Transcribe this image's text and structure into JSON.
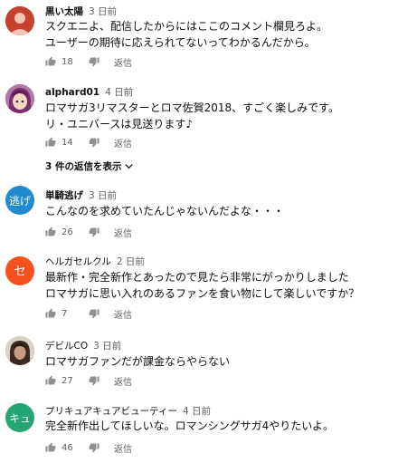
{
  "comments": [
    {
      "author": "黒い太陽",
      "time": "3 日前",
      "avatar": {
        "text": "",
        "color": "#c5422f"
      },
      "lines": [
        "スクエニよ、配信したからにはここのコメント欄見ろよ。",
        "ユーザーの期待に応えられてないってわかるんだから。"
      ],
      "likes": "18",
      "reply_label": "返信"
    },
    {
      "author": "alphard01",
      "time": "4 日前",
      "avatar": {
        "text": "",
        "color": "#8a5a8c"
      },
      "lines": [
        "ロマサガ3リマスターとロマ佐賀2018、すごく楽しみです。",
        "リ・ユニバースは見送ります♪"
      ],
      "likes": "14",
      "reply_label": "返信",
      "view_replies": "3 件の返信を表示"
    },
    {
      "author": "単騎逃げ",
      "time": "3 日前",
      "avatar": {
        "text": "逃げ",
        "color": "#1f8ad0"
      },
      "lines": [
        "こんなのを求めていたんじゃないんだよな・・・"
      ],
      "likes": "26",
      "reply_label": "返信"
    },
    {
      "author": "ヘルガセルクル",
      "time": "2 日前",
      "avatar": {
        "text": "セ",
        "color": "#f4511e"
      },
      "lines": [
        "最新作・完全新作とあったので見たら非常にがっかりしました",
        "ロマサガに思い入れのあるファンを食い物にして楽しいですか？"
      ],
      "likes": "7",
      "reply_label": "返信"
    },
    {
      "author": "デビルCO",
      "time": "3 日前",
      "avatar": {
        "text": "",
        "color": "#5b4636"
      },
      "lines": [
        "ロマサガファンだが課金ならやらない"
      ],
      "likes": "27",
      "reply_label": "返信"
    },
    {
      "author": "プリキュアキュアビューティー",
      "time": "4 日前",
      "avatar": {
        "text": "キュ",
        "color": "#23a574"
      },
      "lines": [
        "完全新作出してほしいな。ロマンシングサガ4やりたいよ。"
      ],
      "likes": "46",
      "reply_label": "返信"
    }
  ]
}
